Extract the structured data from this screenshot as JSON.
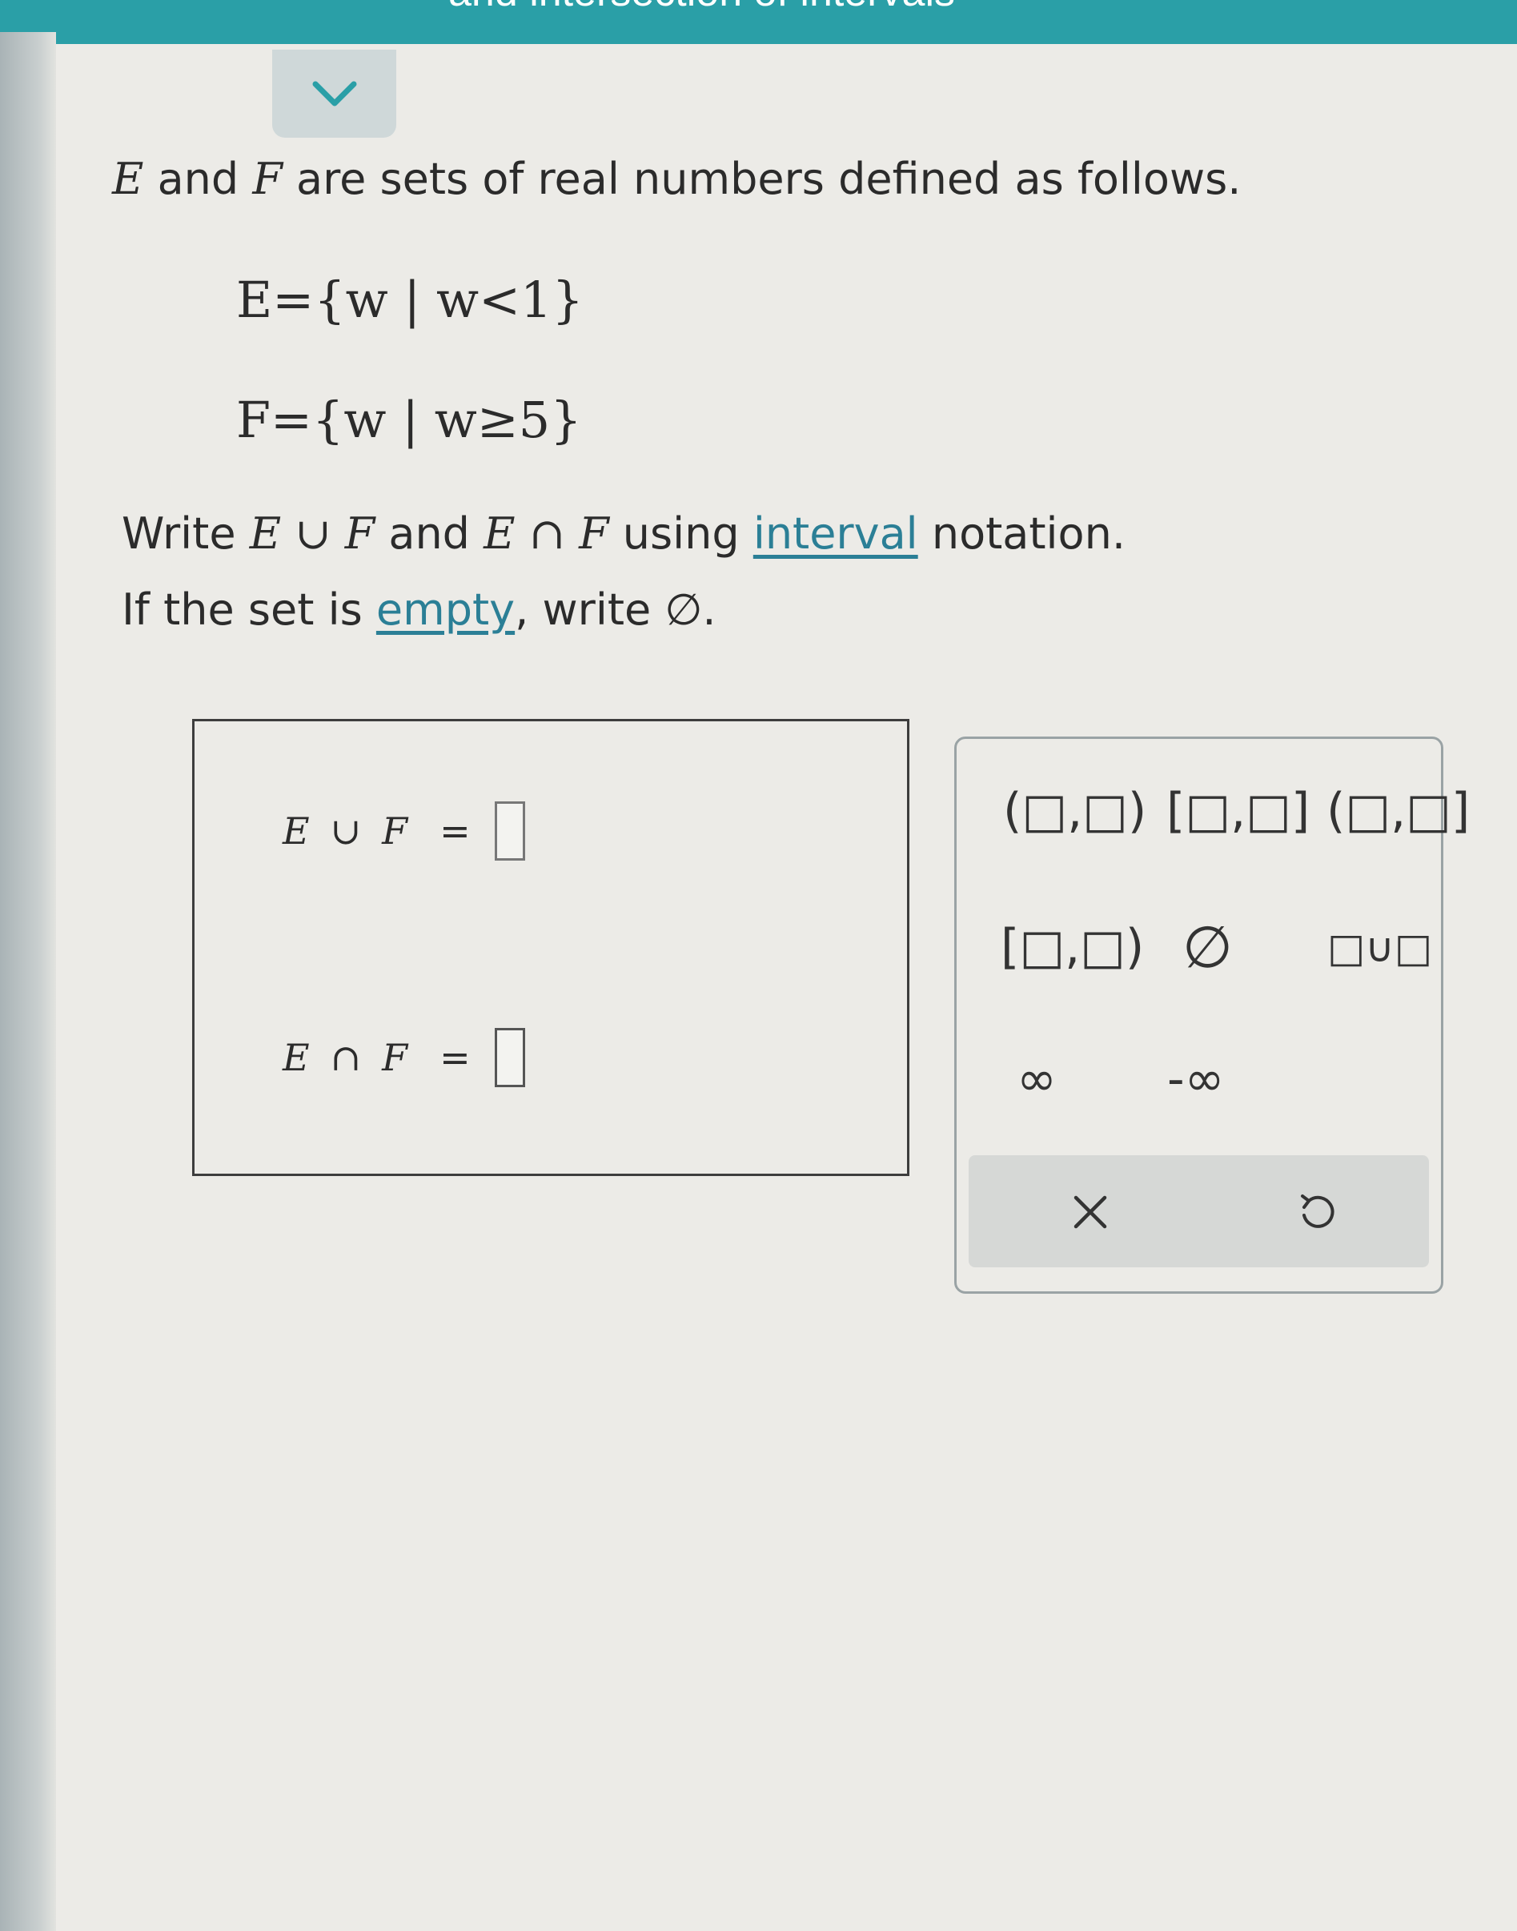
{
  "header": {
    "title": "and intersection of intervals"
  },
  "question": {
    "intro_sets": {
      "e": "E",
      "and": " and ",
      "f": "F"
    },
    "intro_rest": " are sets of real numbers defined as follows.",
    "def_e": "E={w | w<1}",
    "def_f": "F={w | w≥5}",
    "instr_write": "Write ",
    "instr_union": "E ∪ F",
    "instr_and": " and ",
    "instr_inter": "E ∩ F",
    "instr_using": " using ",
    "instr_link": "interval",
    "instr_end": " notation.",
    "instr2_start": "If the set is ",
    "instr2_link": "empty",
    "instr2_end": ", write ∅."
  },
  "answer": {
    "union": {
      "left": "E",
      "op": "∪",
      "right": "F",
      "eq": "="
    },
    "intersection": {
      "left": "E",
      "op": "∩",
      "right": "F",
      "eq": "="
    }
  },
  "keypad": {
    "open_open": "(□,□)",
    "closed_closed": "[□,□]",
    "open_closed": "(□,□]",
    "closed_open": "[□,□)",
    "empty_set": "∅",
    "union": "□∪□",
    "infinity": "∞",
    "neg_infinity": "-∞"
  },
  "colors": {
    "header": "#2a9fa7",
    "link": "#2b7f96",
    "collapse_tab": "#cfd8d9"
  },
  "icons": {
    "collapse": "chevron-down-icon",
    "clear": "x-icon",
    "undo": "undo-icon"
  }
}
